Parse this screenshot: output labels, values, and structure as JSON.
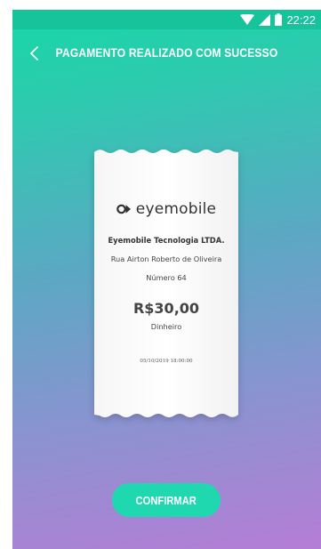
{
  "statusbar": {
    "time": "22:22",
    "icons": [
      "wifi-icon",
      "signal-icon",
      "battery-icon"
    ]
  },
  "header": {
    "back_icon": "chevron-left-icon",
    "title": "PAGAMENTO REALIZADO COM SUCESSO"
  },
  "receipt": {
    "logo_text": "eyemobile",
    "company": "Eyemobile Tecnologia LTDA.",
    "street": "Rua Airton Roberto de Oliveira",
    "number": "Número 64",
    "amount": "R$30,00",
    "payment_method": "Dinheiro",
    "datetime": "05/10/2019 18:00:00"
  },
  "actions": {
    "confirm_label": "CONFIRMAR"
  },
  "colors": {
    "gradient_top": "#17d7a6",
    "gradient_bottom": "#b57dd6",
    "statusbar": "#16c39a",
    "button": "#1fd8b0",
    "receipt": "#ffffff"
  }
}
